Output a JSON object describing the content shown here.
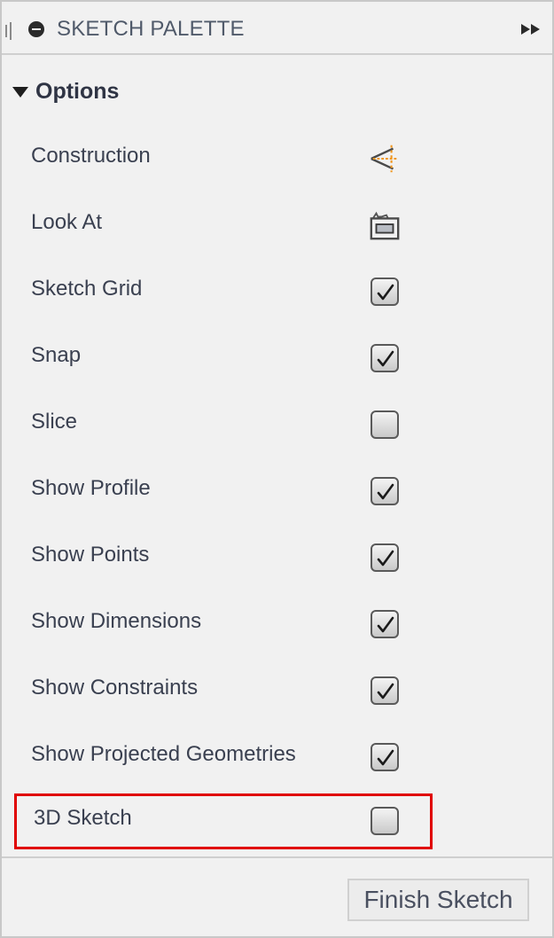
{
  "header": {
    "title": "SKETCH PALETTE"
  },
  "section": {
    "title": "Options",
    "expanded": true
  },
  "options": [
    {
      "label": "Construction",
      "control": "icon",
      "icon": "construction-icon"
    },
    {
      "label": "Look At",
      "control": "icon",
      "icon": "look-at-icon"
    },
    {
      "label": "Sketch Grid",
      "control": "checkbox",
      "checked": true
    },
    {
      "label": "Snap",
      "control": "checkbox",
      "checked": true
    },
    {
      "label": "Slice",
      "control": "checkbox",
      "checked": false
    },
    {
      "label": "Show Profile",
      "control": "checkbox",
      "checked": true
    },
    {
      "label": "Show Points",
      "control": "checkbox",
      "checked": true
    },
    {
      "label": "Show Dimensions",
      "control": "checkbox",
      "checked": true
    },
    {
      "label": "Show Constraints",
      "control": "checkbox",
      "checked": true
    },
    {
      "label": "Show Projected Geometries",
      "control": "checkbox",
      "checked": true
    },
    {
      "label": "3D Sketch",
      "control": "checkbox",
      "checked": false,
      "highlighted": true
    }
  ],
  "footer": {
    "finish_label": "Finish Sketch"
  },
  "colors": {
    "highlight": "#e00000",
    "construction_accent": "#f0961e"
  }
}
